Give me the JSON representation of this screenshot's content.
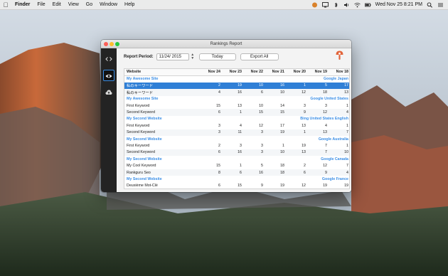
{
  "menubar": {
    "app_name": "Finder",
    "items": [
      "File",
      "Edit",
      "View",
      "Go",
      "Window",
      "Help"
    ],
    "clock": "Wed Nov 25  8:21 PM"
  },
  "window": {
    "title": "Rankings Report"
  },
  "sidebar": {
    "icons": [
      "code-icon",
      "eye-icon",
      "cloud-upload-icon"
    ]
  },
  "toolbar": {
    "period_label": "Report Period:",
    "date_value": "11/24/ 2015",
    "today_label": "Today",
    "export_label": "Export All"
  },
  "table": {
    "columns": [
      "Website",
      "Nov 24",
      "Nov 23",
      "Nov 22",
      "Nov 21",
      "Nov 20",
      "Nov 19",
      "Nov 18"
    ],
    "rows": [
      {
        "type": "site",
        "site": "My Awesome Site",
        "engine": "Google Japan"
      },
      {
        "type": "keyword",
        "keyword": "私のキーワード",
        "values": [
          "2",
          "19",
          "10",
          "16",
          "1",
          "5",
          "17"
        ],
        "selected": true
      },
      {
        "type": "keyword",
        "keyword": "私のキーワード",
        "values": [
          "4",
          "16",
          "6",
          "10",
          "12",
          "18",
          "13"
        ]
      },
      {
        "type": "site",
        "site": "My Awesome Site",
        "engine": "Google United States"
      },
      {
        "type": "keyword",
        "keyword": "First Keyword",
        "values": [
          "15",
          "13",
          "10",
          "14",
          "3",
          "3",
          "1"
        ]
      },
      {
        "type": "keyword",
        "keyword": "Second Keyword",
        "values": [
          "6",
          "1",
          "15",
          "15",
          "9",
          "12",
          "4"
        ]
      },
      {
        "type": "site",
        "site": "My Second Website",
        "engine": "Bing United States English"
      },
      {
        "type": "keyword",
        "keyword": "First Keyword",
        "values": [
          "3",
          "4",
          "12",
          "17",
          "13",
          "4",
          "1"
        ]
      },
      {
        "type": "keyword",
        "keyword": "Second Keyword",
        "values": [
          "3",
          "11",
          "3",
          "19",
          "1",
          "13",
          "7"
        ]
      },
      {
        "type": "site",
        "site": "My Second Website",
        "engine": "Google Australia"
      },
      {
        "type": "keyword",
        "keyword": "First Keyword",
        "values": [
          "2",
          "3",
          "3",
          "1",
          "19",
          "7",
          "1"
        ]
      },
      {
        "type": "keyword",
        "keyword": "Second Keyword",
        "values": [
          "6",
          "16",
          "3",
          "10",
          "13",
          "7",
          "10"
        ]
      },
      {
        "type": "site",
        "site": "My Second Website",
        "engine": "Google Canada"
      },
      {
        "type": "keyword",
        "keyword": "My Cool Keyword",
        "values": [
          "15",
          "1",
          "5",
          "18",
          "2",
          "12",
          "7"
        ]
      },
      {
        "type": "keyword",
        "keyword": "Rankguru Seo",
        "values": [
          "8",
          "6",
          "16",
          "18",
          "6",
          "9",
          "4"
        ]
      },
      {
        "type": "site",
        "site": "My Second Website",
        "engine": "Google France"
      },
      {
        "type": "keyword",
        "keyword": "Deuxième Mot-Clé",
        "values": [
          "6",
          "15",
          "9",
          "19",
          "12",
          "19",
          "19"
        ]
      }
    ]
  },
  "colors": {
    "accent": "#3a8ee6",
    "selection": "#2f7fd6",
    "sidebar": "#232323"
  }
}
